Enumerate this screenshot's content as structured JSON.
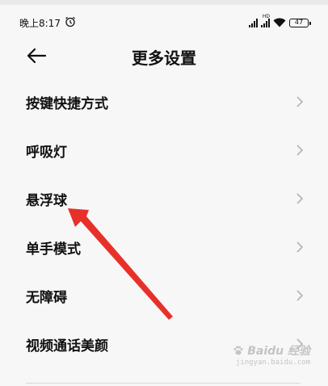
{
  "status_bar": {
    "time": "晚上8:17",
    "battery": "47"
  },
  "header": {
    "title": "更多设置",
    "back_icon": "arrow-left-icon"
  },
  "menu": {
    "items": [
      {
        "label": "按键快捷方式"
      },
      {
        "label": "呼吸灯"
      },
      {
        "label": "悬浮球"
      },
      {
        "label": "单手模式"
      },
      {
        "label": "无障碍"
      },
      {
        "label": "视频通话美颜"
      }
    ]
  },
  "annotation": {
    "color": "#e8302a",
    "points_to": "悬浮球"
  },
  "watermark": {
    "brand": "Baidu 经验",
    "url": "jingyan.baidu.com"
  }
}
